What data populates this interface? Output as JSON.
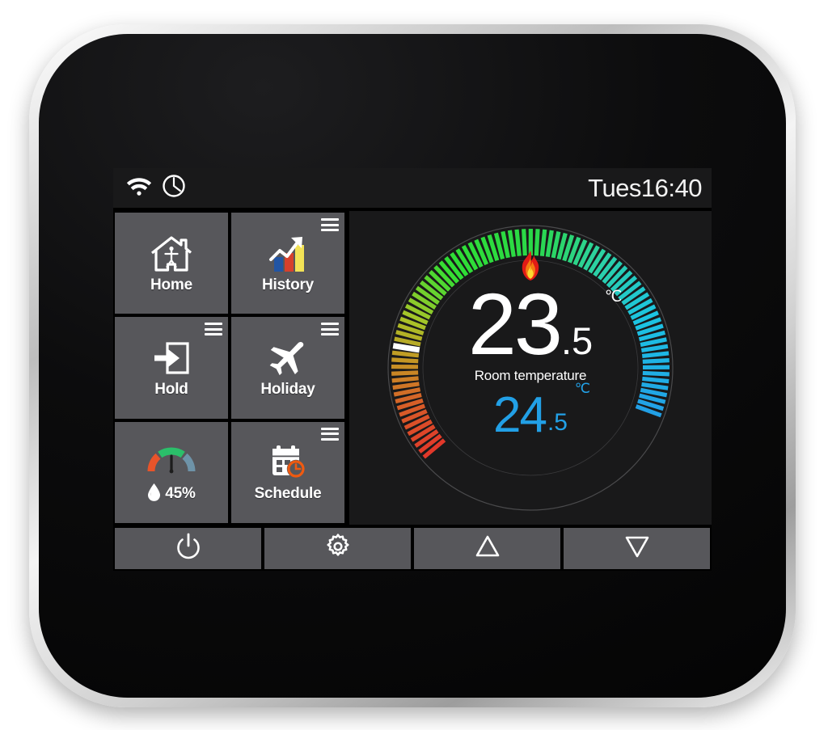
{
  "device": {
    "type": "smart-thermostat",
    "bezel_color": "#c9c9c9",
    "glass_color": "#0b0b0c"
  },
  "status_bar": {
    "wifi_icon": "wifi-icon",
    "clock_icon": "clock-icon",
    "datetime": "Tues16:40"
  },
  "tiles": [
    {
      "id": "home",
      "label": "Home",
      "icon": "house-person-icon",
      "menu": false
    },
    {
      "id": "history",
      "label": "History",
      "icon": "bar-chart-trend-icon",
      "menu": true
    },
    {
      "id": "hold",
      "label": "Hold",
      "icon": "arrow-into-door-icon",
      "menu": true
    },
    {
      "id": "holiday",
      "label": "Holiday",
      "icon": "airplane-icon",
      "menu": true
    },
    {
      "id": "humidity",
      "label": "45%",
      "icon": "humidity-gauge-icon",
      "menu": false
    },
    {
      "id": "schedule",
      "label": "Schedule",
      "icon": "calendar-clock-icon",
      "menu": true
    }
  ],
  "dial": {
    "heating_icon": "flame-icon",
    "room_temperature": {
      "whole": "23",
      "decimal": ".5",
      "unit": "℃",
      "caption": "Room temperature"
    },
    "set_temperature": {
      "whole": "24",
      "decimal": ".5",
      "unit": "℃"
    },
    "marker_color": "#ffffff",
    "set_temp_color": "#22a0e6",
    "tick_count": 84,
    "marker_tick_index": 66
  },
  "humidity": {
    "value": "45%",
    "droplet_icon": "water-drop-icon",
    "gauge_colors": [
      "#e8542a",
      "#2bbf6a",
      "#6e93a8"
    ]
  },
  "history_icon_colors": {
    "bar1": "#2255a4",
    "bar2": "#d6402c",
    "bar3": "#f2e256"
  },
  "schedule_icon_colors": {
    "calendar": "#ffffff",
    "clock": "#ef5a10"
  },
  "flame_colors": {
    "outer": "#e21b16",
    "mid": "#f57b12",
    "inner": "#fbd832"
  },
  "buttons": [
    {
      "id": "power",
      "icon": "power-icon"
    },
    {
      "id": "settings",
      "icon": "gear-icon"
    },
    {
      "id": "temp-up",
      "icon": "triangle-up-icon"
    },
    {
      "id": "temp-down",
      "icon": "triangle-down-icon"
    }
  ]
}
